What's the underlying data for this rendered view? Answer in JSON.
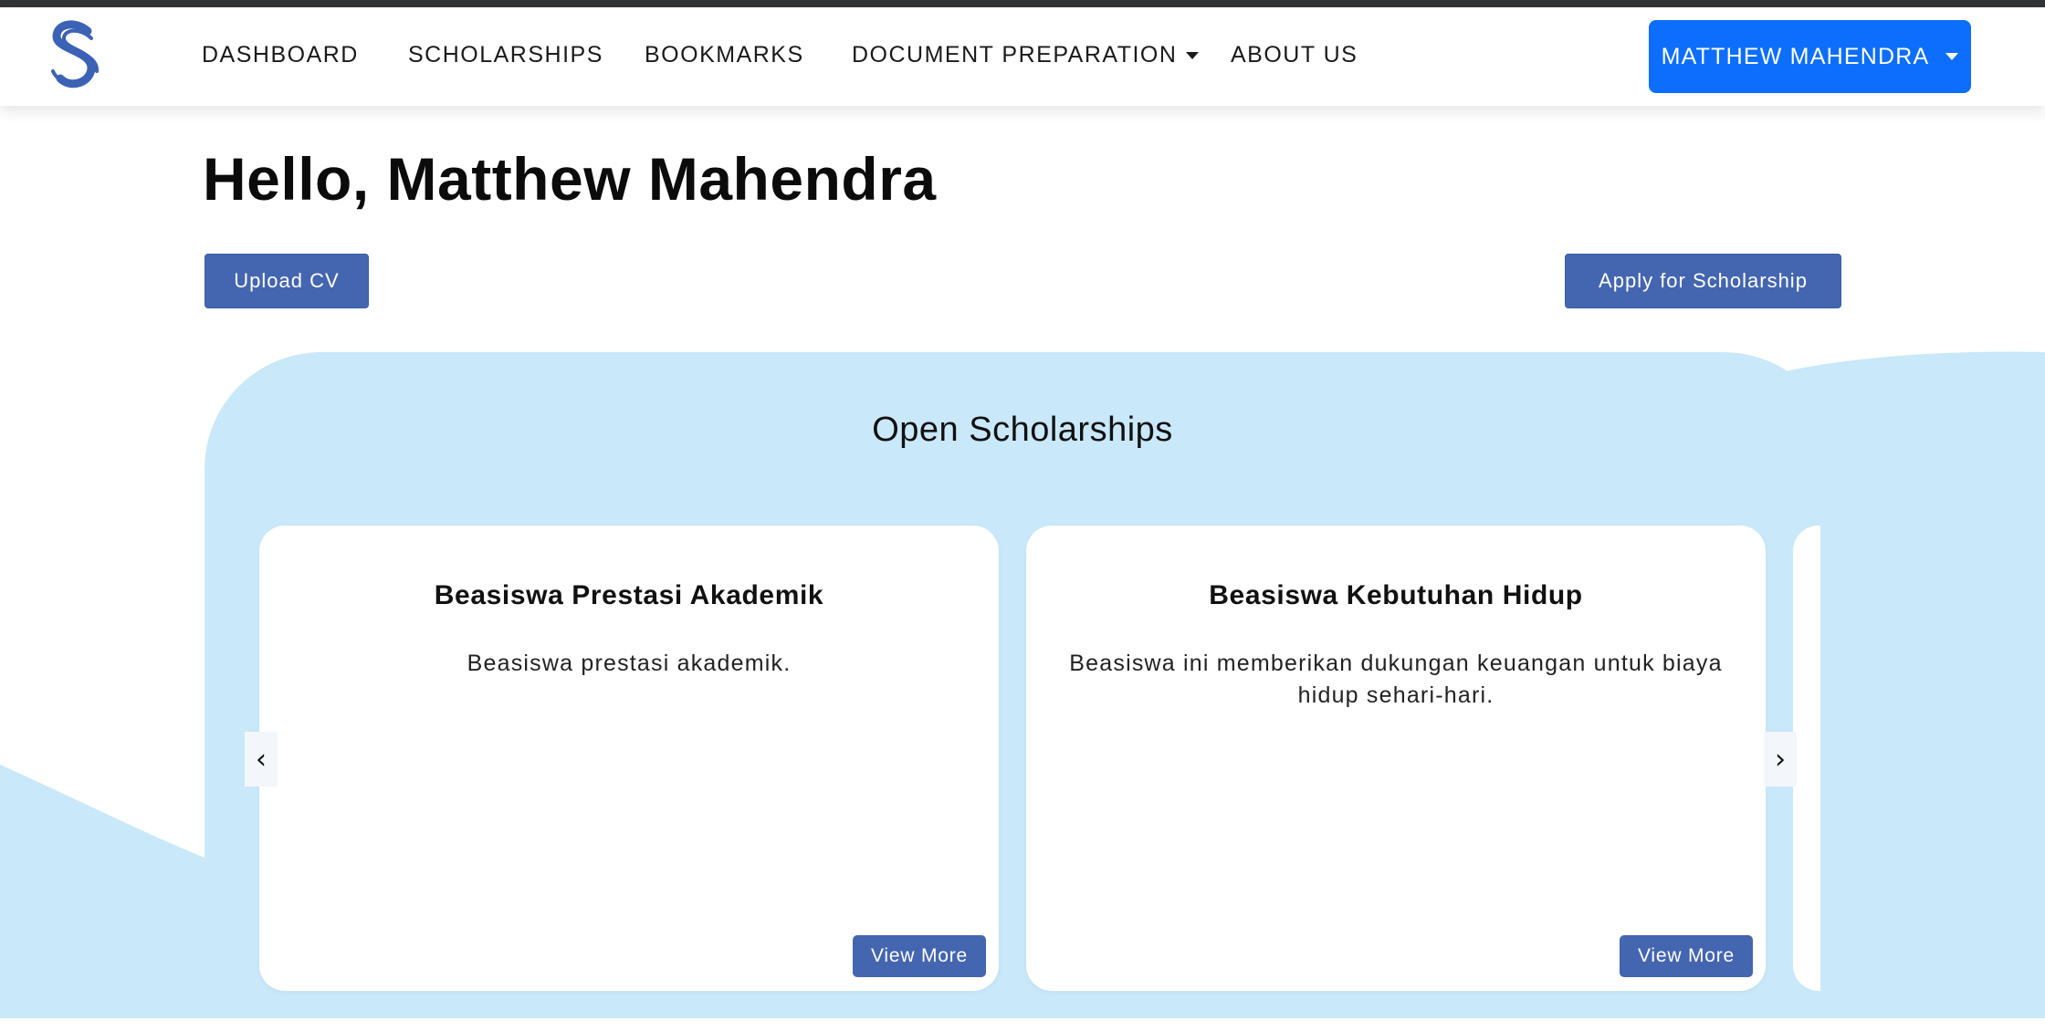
{
  "nav": {
    "links": [
      "DASHBOARD",
      "SCHOLARSHIPS",
      "BOOKMARKS",
      "DOCUMENT PREPARATION",
      "ABOUT US"
    ],
    "user_button": "MATTHEW MAHENDRA",
    "logo_icon": "scholarship-s-logo",
    "accent_color": "#0d6efd"
  },
  "greeting": "Hello, Matthew Mahendra",
  "actions": {
    "upload_cv": "Upload CV",
    "apply": "Apply for Scholarship"
  },
  "open_scholarships": {
    "title": "Open Scholarships",
    "cards": [
      {
        "title": "Beasiswa Prestasi Akademik",
        "description": "Beasiswa prestasi akademik.",
        "button": "View More"
      },
      {
        "title": "Beasiswa Kebutuhan Hidup",
        "description": "Beasiswa ini memberikan dukungan keuangan untuk biaya hidup sehari-hari.",
        "button": "View More"
      }
    ],
    "prev_icon": "‹",
    "next_icon": "›"
  },
  "colors": {
    "button": "#4466b0",
    "panel_bg": "#c9e8f9"
  }
}
